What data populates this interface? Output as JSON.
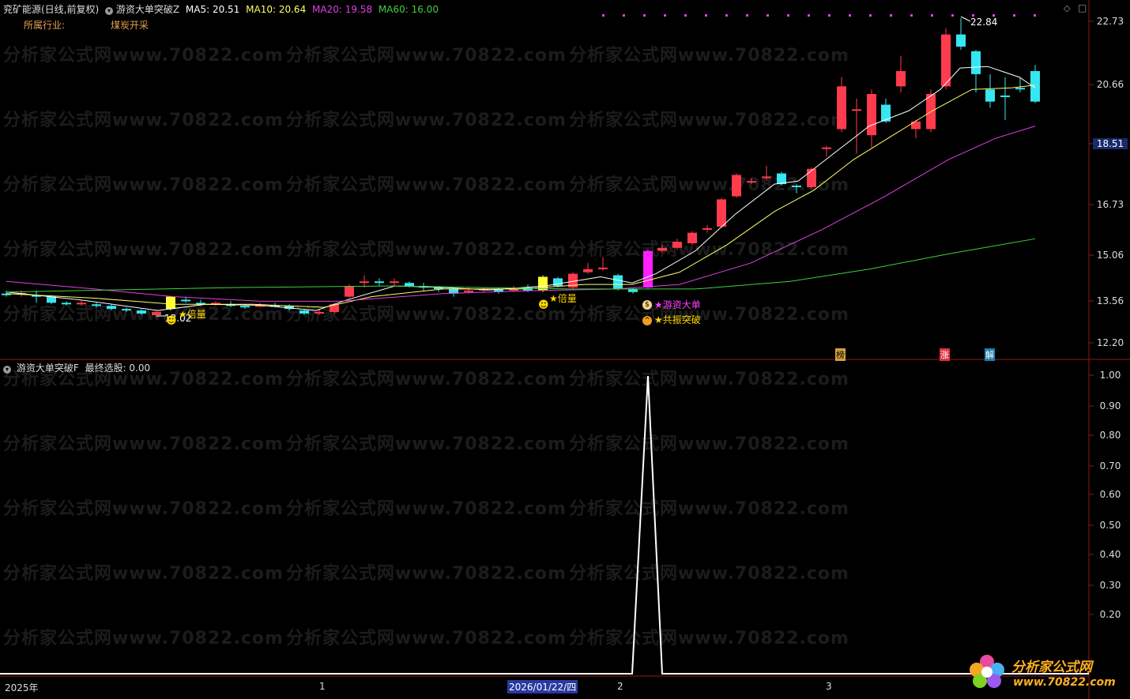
{
  "main_panel": {
    "stock_label": "兖矿能源(日线,前复权)",
    "indicator_name": "游资大单突破Z",
    "ma5_label": "MA5: 20.51",
    "ma10_label": "MA10: 20.64",
    "ma20_label": "MA20: 19.58",
    "ma60_label": "MA60: 16.00",
    "industry_label": "所属行业:",
    "industry_value": "煤炭开采",
    "colors": {
      "up": "#ff3b4e",
      "down": "#36e6f0",
      "ma5": "#ffffff",
      "ma10": "#ffff66",
      "ma20": "#e040e0",
      "ma60": "#40d040"
    },
    "y_axis_ticks": [
      "22.73",
      "20.66",
      "18.51",
      "16.73",
      "15.06",
      "13.56",
      "12.20"
    ],
    "highlight_price": "18.51",
    "high_marker": "22.84",
    "low_marker": "13.02",
    "annotations": {
      "bei_liang_1": "★倍量",
      "bei_liang_2": "★倍量",
      "you_zi_da_dan": "★游资大单",
      "gong_zhen_tu_po": "★共振突破"
    },
    "badges": {
      "bang": "榜",
      "zhang": "涨",
      "jie": "解"
    }
  },
  "sub_panel": {
    "indicator_name": "游资大单突破F",
    "value_label": "最终选股: 0.00",
    "y_axis_ticks": [
      "1.00",
      "0.90",
      "0.80",
      "0.70",
      "0.60",
      "0.50",
      "0.40",
      "0.30",
      "0.20"
    ]
  },
  "x_axis": {
    "labels": [
      "2025年",
      "1",
      "2",
      "3"
    ],
    "cursor_date": "2026/01/22/四"
  },
  "watermark": "分析家公式网www.70822.com",
  "logo": {
    "title": "分析家公式网",
    "url": "www.70822.com"
  }
}
